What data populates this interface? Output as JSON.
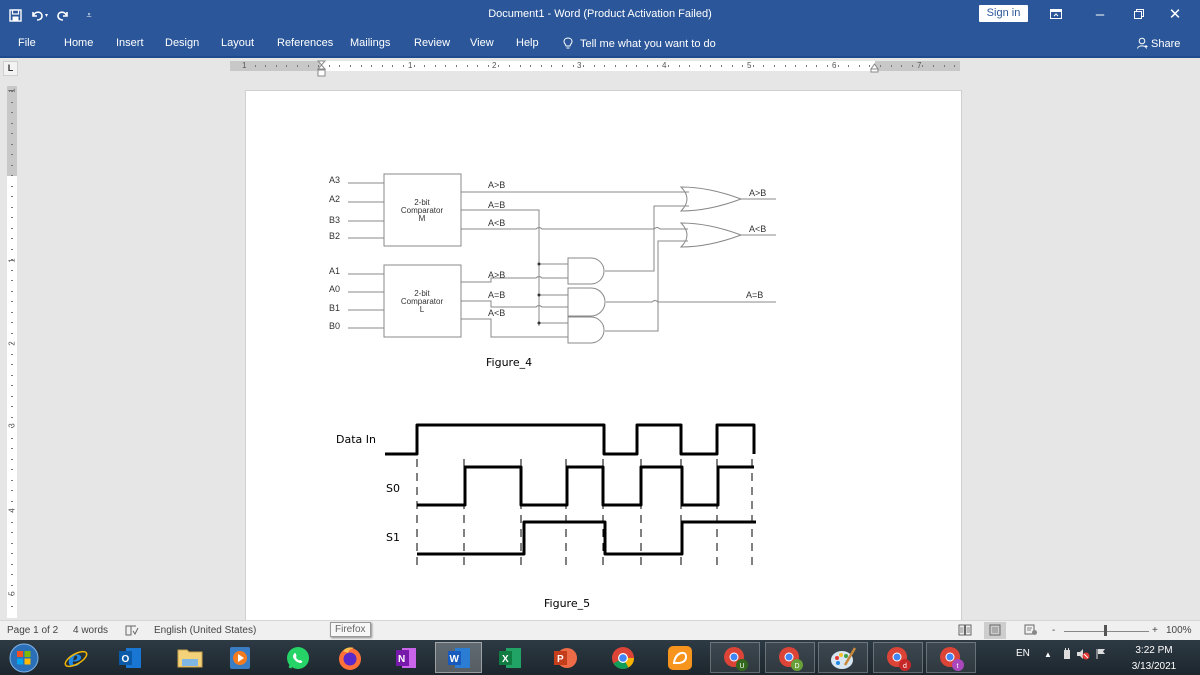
{
  "titlebar": {
    "title": "Document1  -  Word (Product Activation Failed)",
    "sign_in": "Sign in",
    "qat_icons": [
      "save-icon",
      "undo-icon",
      "redo-icon",
      "customize-qat-icon"
    ],
    "window_buttons": [
      "ribbon-display-icon",
      "minimize-icon",
      "restore-icon",
      "close-icon"
    ]
  },
  "ribbon": {
    "tabs": [
      "File",
      "Home",
      "Insert",
      "Design",
      "Layout",
      "References",
      "Mailings",
      "Review",
      "View",
      "Help"
    ],
    "tell_me": "Tell me what you want to do",
    "share": "Share"
  },
  "ruler": {
    "horizontal_numbers": [
      "1",
      "1",
      "2",
      "3",
      "4",
      "5",
      "6",
      "7"
    ],
    "vertical_numbers": [
      "1",
      "1",
      "2",
      "3",
      "4",
      "5"
    ]
  },
  "document": {
    "figure4": {
      "caption": "Figure_4",
      "comparator_m": {
        "line1": "2-bit",
        "line2": "Comparator",
        "line3": "M"
      },
      "comparator_l": {
        "line1": "2-bit",
        "line2": "Comparator",
        "line3": "L"
      },
      "inputs_m": [
        "A3",
        "A2",
        "B3",
        "B2"
      ],
      "inputs_l": [
        "A1",
        "A0",
        "B1",
        "B0"
      ],
      "outputs_m": [
        "A>B",
        "A=B",
        "A<B"
      ],
      "outputs_l": [
        "A>B",
        "A=B",
        "A<B"
      ],
      "final_outputs": [
        "A>B",
        "A<B",
        "A=B"
      ]
    },
    "figure5": {
      "caption": "Figure_5",
      "signals": [
        {
          "name": "Data In",
          "levels": [
            1,
            1,
            0,
            1,
            0,
            1,
            0
          ]
        },
        {
          "name": "S0",
          "levels": [
            0,
            1,
            0,
            1,
            0,
            1,
            0,
            1
          ]
        },
        {
          "name": "S1",
          "levels": [
            0,
            1,
            0,
            1
          ]
        }
      ]
    }
  },
  "statusbar": {
    "page": "Page 1 of 2",
    "words": "4 words",
    "language": "English (United States)",
    "zoom": "100%",
    "zoom_minus": "-",
    "zoom_plus": "+",
    "tooltip": "Firefox"
  },
  "taskbar": {
    "apps": [
      "Start",
      "Internet Explorer",
      "Outlook",
      "File Explorer",
      "Media Player",
      "WhatsApp",
      "Firefox",
      "OneNote",
      "Word",
      "Excel",
      "PowerPoint",
      "Chrome",
      "UC Browser",
      "Chrome (U)",
      "Chrome (D)",
      "Paint",
      "Chrome (d)",
      "Chrome (t)"
    ],
    "language": "EN",
    "time": "3:22 PM",
    "date": "3/13/2021"
  }
}
